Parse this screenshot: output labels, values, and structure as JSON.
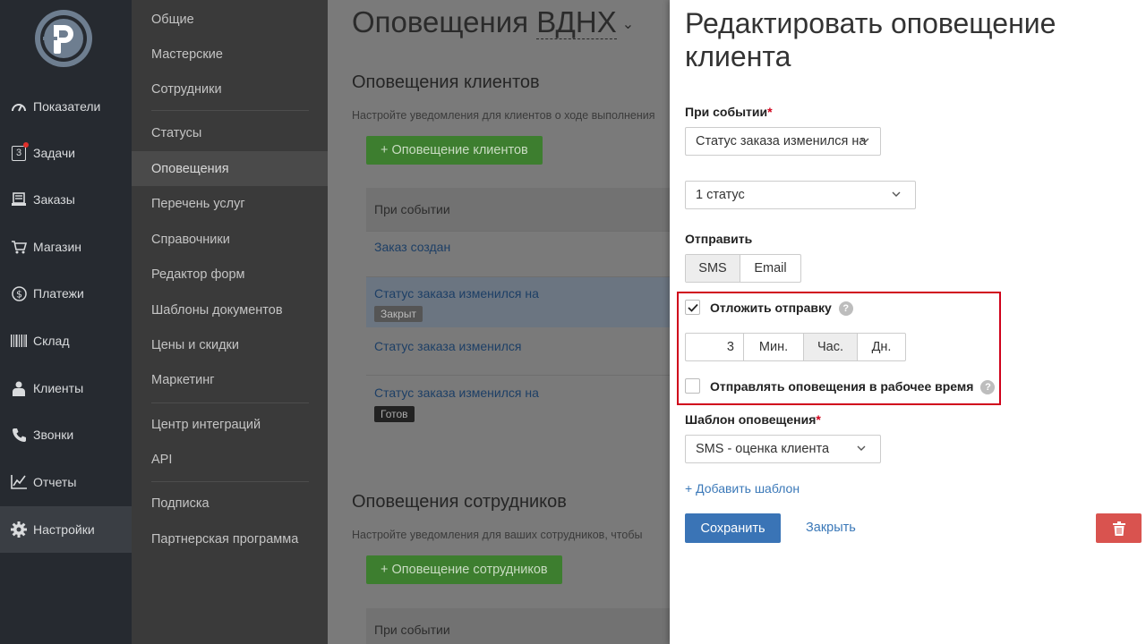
{
  "nav": {
    "items": [
      {
        "label": "Показатели",
        "icon": "dashboard-icon"
      },
      {
        "label": "Задачи",
        "icon": "tasks-icon",
        "badge": "3"
      },
      {
        "label": "Заказы",
        "icon": "orders-icon"
      },
      {
        "label": "Магазин",
        "icon": "cart-icon"
      },
      {
        "label": "Платежи",
        "icon": "dollar-icon"
      },
      {
        "label": "Склад",
        "icon": "barcode-icon"
      },
      {
        "label": "Клиенты",
        "icon": "clients-icon"
      },
      {
        "label": "Звонки",
        "icon": "phone-icon"
      },
      {
        "label": "Отчеты",
        "icon": "chart-icon"
      },
      {
        "label": "Настройки",
        "icon": "gear-icon"
      }
    ],
    "active": "Настройки"
  },
  "submenu": {
    "items": [
      "Общие",
      "Мастерские",
      "Сотрудники",
      "Статусы",
      "Оповещения",
      "Перечень услуг",
      "Справочники",
      "Редактор форм",
      "Шаблоны документов",
      "Цены и скидки",
      "Маркетинг",
      "Центр интеграций",
      "API",
      "Подписка",
      "Партнерская программа"
    ],
    "active": "Оповещения"
  },
  "main": {
    "title_prefix": "Оповещения",
    "title_location": "ВДНХ",
    "clients": {
      "title": "Оповещения клиентов",
      "description": "Настройте уведомления для клиентов о ходе выполнения",
      "add_button": "+ Оповещение клиентов",
      "table_header": "При событии",
      "rows": [
        {
          "event": "Заказ создан"
        },
        {
          "event": "Статус заказа изменился на",
          "tag": "Закрыт"
        },
        {
          "event": "Статус заказа изменился"
        },
        {
          "event": "Статус заказа изменился на",
          "tag": "Готов"
        }
      ]
    },
    "employees": {
      "title": "Оповещения сотрудников",
      "description": "Настройте уведомления для ваших сотрудников, чтобы",
      "add_button": "+ Оповещение сотрудников",
      "table_header": "При событии"
    }
  },
  "panel": {
    "title": "Редактировать оповещение клиента",
    "event_label": "При событии",
    "event_value": "Статус заказа изменился на",
    "status_value": "1 статус",
    "send_label": "Отправить",
    "channels": [
      "SMS",
      "Email"
    ],
    "channel_selected": "SMS",
    "delay_label": "Отложить отправку",
    "delay_checked": true,
    "delay_value": "3",
    "delay_units": [
      "Мин.",
      "Час.",
      "Дн."
    ],
    "delay_unit_selected": "Час.",
    "worktime_label": "Отправлять оповещения в рабочее время",
    "worktime_checked": false,
    "help_symbol": "?",
    "template_label": "Шаблон оповещения",
    "template_value": "SMS - оценка клиента",
    "add_template": "+ Добавить шаблон",
    "save": "Сохранить",
    "close": "Закрыть",
    "delete_icon": "trash-icon",
    "required_mark": "*"
  },
  "colors": {
    "primary": "#3a74b6",
    "danger": "#d9534f",
    "highlight": "#d0021b",
    "nav_bg": "#262a30"
  }
}
